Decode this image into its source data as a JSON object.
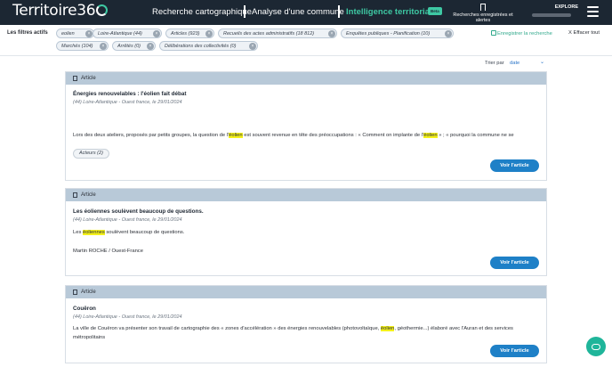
{
  "header": {
    "logo_text": "Territoire36",
    "nav": [
      "Recherche cartographique",
      "Analyse d'une commune",
      "Intelligence territoriale"
    ],
    "beta_label": "Beta",
    "saved_label": "Recherches enregistrées et alertes",
    "explore_label": "EXPLORE",
    "icons": {
      "saved": "bookmark-icon",
      "menu": "hamburger-icon"
    }
  },
  "filters": {
    "label": "Les filtres actifs",
    "chips": [
      "eolien",
      "Loire-Atlantique (44)",
      "Articles (923)",
      "Recueils des actes administratifs (18 812)",
      "Enquêtes publiques - Planification (10)",
      "Marchés (104)",
      "Arrêtés (0)",
      "Délibérations des collectivités (0)"
    ],
    "save_label": "Enregistrer la recherche",
    "clear_label": "X Effacer tout"
  },
  "sort": {
    "label": "Trier par",
    "value": "date"
  },
  "cards": [
    {
      "type": "Article",
      "title": "Énergies renouvelables : l'éolien fait débat",
      "meta": "(44) Loire-Atlantique - Ouest france, le 29/01/2024",
      "text_parts": [
        "Lors des deux ateliers, proposés par petits groupes, la question de l'",
        "éolien",
        " est souvent revenue en tête des préoccupations : « Comment on implante de l'",
        "éolien",
        " » ; « pourquoi la commune ne se"
      ],
      "tag": "Acteurs (2)",
      "button": "Voir l'article"
    },
    {
      "type": "Article",
      "title": "Les éoliennes soulèvent beaucoup de questions.",
      "meta": "(44) Loire-Atlantique - Ouest france, le 29/01/2024",
      "text_parts": [
        "Les ",
        "éoliennes",
        " soulèvent beaucoup de questions."
      ],
      "author": "Martin ROCHE / Ouest-France",
      "button": "Voir l'article"
    },
    {
      "type": "Article",
      "title": "Couëron",
      "meta": "(44) Loire-Atlantique - Ouest france, le 29/01/2024",
      "text_parts": [
        "La ville de Couëron va présenter son travail de cartographie des « zones d'accélération » des énergies renouvelables (photovoltaïque, ",
        "éolien",
        ", géothermie...) élaboré avec l'Auran et des services métropolitains"
      ],
      "button": "Voir l'article"
    }
  ],
  "colors": {
    "header_bg": "#1c2733",
    "accent": "#3ec8a3",
    "button": "#1e80c7",
    "highlight": "#f4f11a"
  }
}
